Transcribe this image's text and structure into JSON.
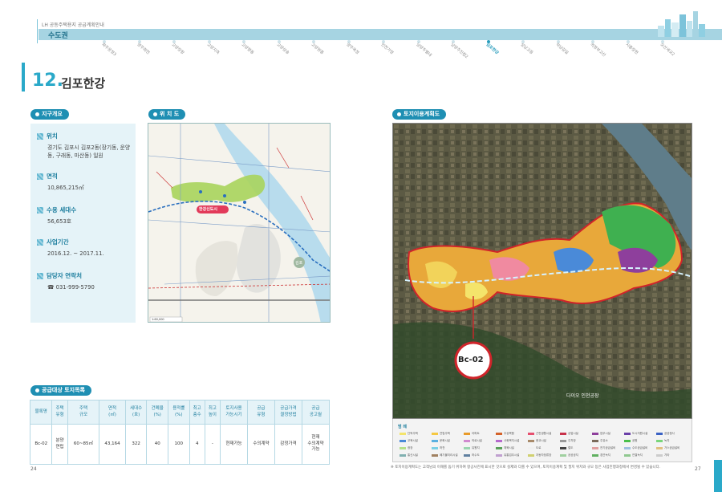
{
  "header": {
    "series_label": "LH 공동주택용지 공급계획안내",
    "region": "수도권"
  },
  "nav": {
    "items": [
      {
        "label": "파주운정3",
        "active": false
      },
      {
        "label": "양주회천",
        "active": false
      },
      {
        "label": "고양장항",
        "active": false
      },
      {
        "label": "고양지축",
        "active": false
      },
      {
        "label": "고양향동",
        "active": false
      },
      {
        "label": "고양삼송",
        "active": false
      },
      {
        "label": "고양원흥",
        "active": false
      },
      {
        "label": "양주옥정",
        "active": false
      },
      {
        "label": "인천가정",
        "active": false
      },
      {
        "label": "남양주별내",
        "active": false
      },
      {
        "label": "남양주진접2",
        "active": false
      },
      {
        "label": "김포한강",
        "active": true
      },
      {
        "label": "성남고등",
        "active": false
      },
      {
        "label": "하남감일",
        "active": false
      },
      {
        "label": "의정부고산",
        "active": false
      },
      {
        "label": "시흥장현",
        "active": false
      },
      {
        "label": "오산세교2",
        "active": false
      }
    ]
  },
  "section": {
    "number": "12.",
    "title": "김포한강"
  },
  "overview": {
    "heading": "지구개요",
    "items": [
      {
        "label": "위치",
        "value": "경기도 김포시 김포2동(장기동, 운양동, 구래동, 마산동) 일원"
      },
      {
        "label": "면적",
        "value": "10,865,215㎡"
      },
      {
        "label": "수용 세대수",
        "value": "56,653호"
      },
      {
        "label": "사업기간",
        "value": "2016.12. ~ 2017.11."
      },
      {
        "label": "담당자 연락처",
        "value": "☎ 031-999-5790"
      }
    ]
  },
  "location": {
    "heading": "위 치 도",
    "district_label": "한강신도시",
    "city_label": "김포",
    "scale": "1:60,000"
  },
  "landuse": {
    "heading": "토지이용계획도",
    "lot_label": "Bc-02",
    "place_label": "다이오 인천공장",
    "legend_title": "범 례"
  },
  "supply": {
    "heading": "공급대상 토지목록",
    "columns": [
      "블록명",
      "주택\n유형",
      "주택\n규모",
      "면적\n(㎡)",
      "세대수\n(호)",
      "건폐율\n(%)",
      "용적률\n(%)",
      "최고\n층수",
      "최고\n높이",
      "토지사용\n가능시기",
      "공급\n유형",
      "공급가격\n결정방법",
      "공급\n공고월"
    ],
    "rows": [
      [
        "Bc-02",
        "분양\n연립",
        "60~85㎡",
        "43,164",
        "322",
        "40",
        "100",
        "4",
        "-",
        "현재가능",
        "수의계약",
        "감정가격",
        "현재\n수의계약\n가능"
      ]
    ]
  },
  "legend": {
    "items": [
      {
        "label": "단독주택",
        "color": "#f4e46b"
      },
      {
        "label": "연립주택",
        "color": "#f5c842"
      },
      {
        "label": "아파트",
        "color": "#e89a2a"
      },
      {
        "label": "주상복합",
        "color": "#d4622a"
      },
      {
        "label": "근린생활시설",
        "color": "#e6506f"
      },
      {
        "label": "상업시설",
        "color": "#c8324a"
      },
      {
        "label": "업무시설",
        "color": "#8e3f9c"
      },
      {
        "label": "도시지원시설",
        "color": "#6a3fa8"
      },
      {
        "label": "공공청사",
        "color": "#3a62c4"
      },
      {
        "label": "교육시설",
        "color": "#4a8ad8"
      },
      {
        "label": "문화시설",
        "color": "#5ab0e0"
      },
      {
        "label": "의료시설",
        "color": "#d18ad0"
      },
      {
        "label": "사회복지시설",
        "color": "#b56acd"
      },
      {
        "label": "종교시설",
        "color": "#a88a6a"
      },
      {
        "label": "주차장",
        "color": "#9a9a9a"
      },
      {
        "label": "주유소",
        "color": "#7a6a5a"
      },
      {
        "label": "공원",
        "color": "#4ac04a"
      },
      {
        "label": "녹지",
        "color": "#7ad67a"
      },
      {
        "label": "광장",
        "color": "#b4e08a"
      },
      {
        "label": "하천",
        "color": "#7ad0e6"
      },
      {
        "label": "유원지",
        "color": "#9ad6b0"
      },
      {
        "label": "체육시설",
        "color": "#5aa05a"
      },
      {
        "label": "도로",
        "color": "#f0f0f0"
      },
      {
        "label": "철도",
        "color": "#444444"
      },
      {
        "label": "전기공급설비",
        "color": "#e0a0a0"
      },
      {
        "label": "수도공급설비",
        "color": "#a0c0e0"
      },
      {
        "label": "가스공급설비",
        "color": "#e0c080"
      },
      {
        "label": "통신시설",
        "color": "#80b0b0"
      },
      {
        "label": "폐기물처리시설",
        "color": "#a08060"
      },
      {
        "label": "하수도",
        "color": "#6080a0"
      },
      {
        "label": "유통업무시설",
        "color": "#c0a0d0"
      },
      {
        "label": "자동차정류장",
        "color": "#d0d070"
      },
      {
        "label": "공공공지",
        "color": "#a0d0a0"
      },
      {
        "label": "경관녹지",
        "color": "#60b060"
      },
      {
        "label": "연결녹지",
        "color": "#90c890"
      },
      {
        "label": "기타",
        "color": "#cccccc"
      }
    ]
  },
  "footnote": "※ 토지이용계획도는 고객님의 이해를 돕기 위하여 항공사진에 표시한 것으로 실제와 다를 수 있으며, 토지이용계획 및 필지 위치와 규모 등은 사업진행과정에서 변경될 수 있습니다.",
  "pages": {
    "left": "24",
    "right": "27"
  }
}
